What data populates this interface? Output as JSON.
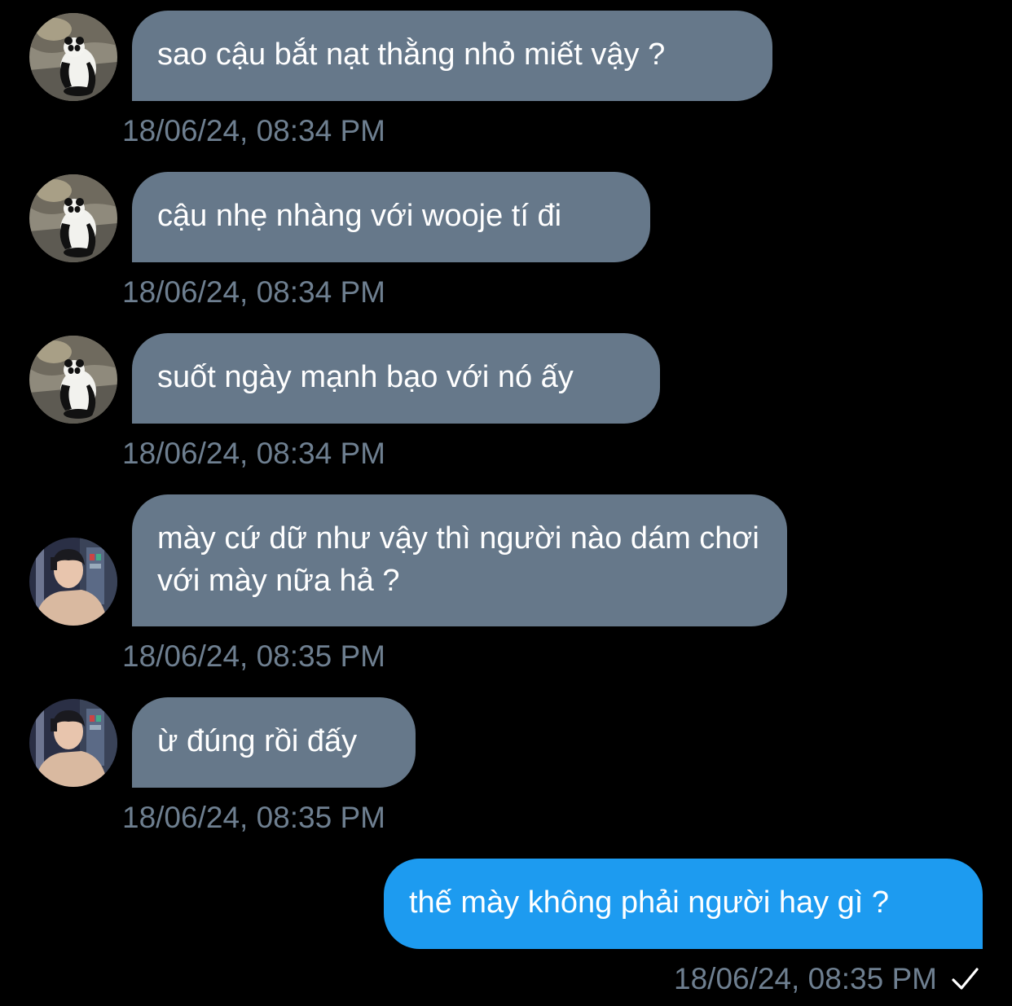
{
  "messages": [
    {
      "text": "sao cậu bắt nạt thằng nhỏ miết vậy ?",
      "time": "18/06/24, 08:34 PM",
      "avatar": "panda"
    },
    {
      "text": "cậu nhẹ nhàng với wooje tí đi",
      "time": "18/06/24, 08:34 PM",
      "avatar": "panda"
    },
    {
      "text": "suốt ngày mạnh bạo với nó ấy",
      "time": "18/06/24, 08:34 PM",
      "avatar": "panda"
    },
    {
      "text": "mày cứ dữ như vậy thì người nào dám chơi với mày nữa hả ?",
      "time": "18/06/24, 08:35 PM",
      "avatar": "person"
    },
    {
      "text": "ừ đúng rồi đấy",
      "time": "18/06/24, 08:35 PM",
      "avatar": "person"
    }
  ],
  "outgoing": {
    "text": "thế mày không phải người hay gì ?",
    "time": "18/06/24, 08:35 PM",
    "status_icon": "checkmark-icon"
  },
  "colors": {
    "background": "#000000",
    "incoming_bubble": "#66788a",
    "outgoing_bubble": "#1d9bf0",
    "timestamp": "#6e7f90"
  }
}
